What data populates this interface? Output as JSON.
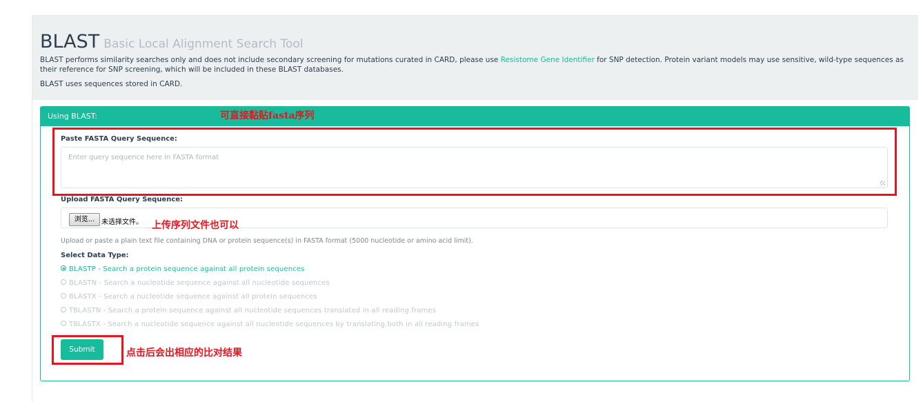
{
  "header": {
    "title": "BLAST",
    "subtitle": "Basic Local Alignment Search Tool",
    "desc_before_link": "BLAST performs similarity searches only and does not include secondary screening for mutations curated in CARD, please use ",
    "desc_link": "Resistome Gene Identifier",
    "desc_after_link": " for SNP detection. Protein variant models may use sensitive, wild-type sequences as their reference for SNP screening, which will be included in these BLAST databases.",
    "note": "BLAST uses sequences stored in CARD."
  },
  "panel": {
    "heading": "Using BLAST:",
    "paste_label": "Paste FASTA Query Sequence:",
    "paste_placeholder": "Enter query sequence here in FASTA format",
    "upload_label": "Upload FASTA Query Sequence:",
    "file_button": "浏览...",
    "file_status": "未选择文件。",
    "help_text": "Upload or paste a plain text file containing DNA or protein sequence(s) in FASTA format (5000 nucleotide or amino acid limit).",
    "data_type_label": "Select Data Type:",
    "options": [
      {
        "label": "BLASTP - Search a protein sequence against all protein sequences",
        "selected": true
      },
      {
        "label": "BLASTN - Search a nucleotide sequence against all nucleotide sequences",
        "selected": false
      },
      {
        "label": "BLASTX - Search a nucleotide sequence against all protein sequences",
        "selected": false
      },
      {
        "label": "TBLASTN - Search a protein sequence against all nucleotide sequences translated in all reading frames",
        "selected": false
      },
      {
        "label": "TBLASTX - Search a nucleotide sequence against all nucleotide sequences by translating both in all reading frames",
        "selected": false
      }
    ],
    "submit_label": "Submit"
  },
  "annotations": {
    "paste": "可直接黏贴fasta序列",
    "upload": "上传序列文件也可以",
    "submit": "点击后会出相应的比对结果"
  },
  "colors": {
    "accent": "#18bc9c",
    "annotation": "#e8141e",
    "hero_bg": "#ecf0f1",
    "text": "#2c3e50"
  }
}
